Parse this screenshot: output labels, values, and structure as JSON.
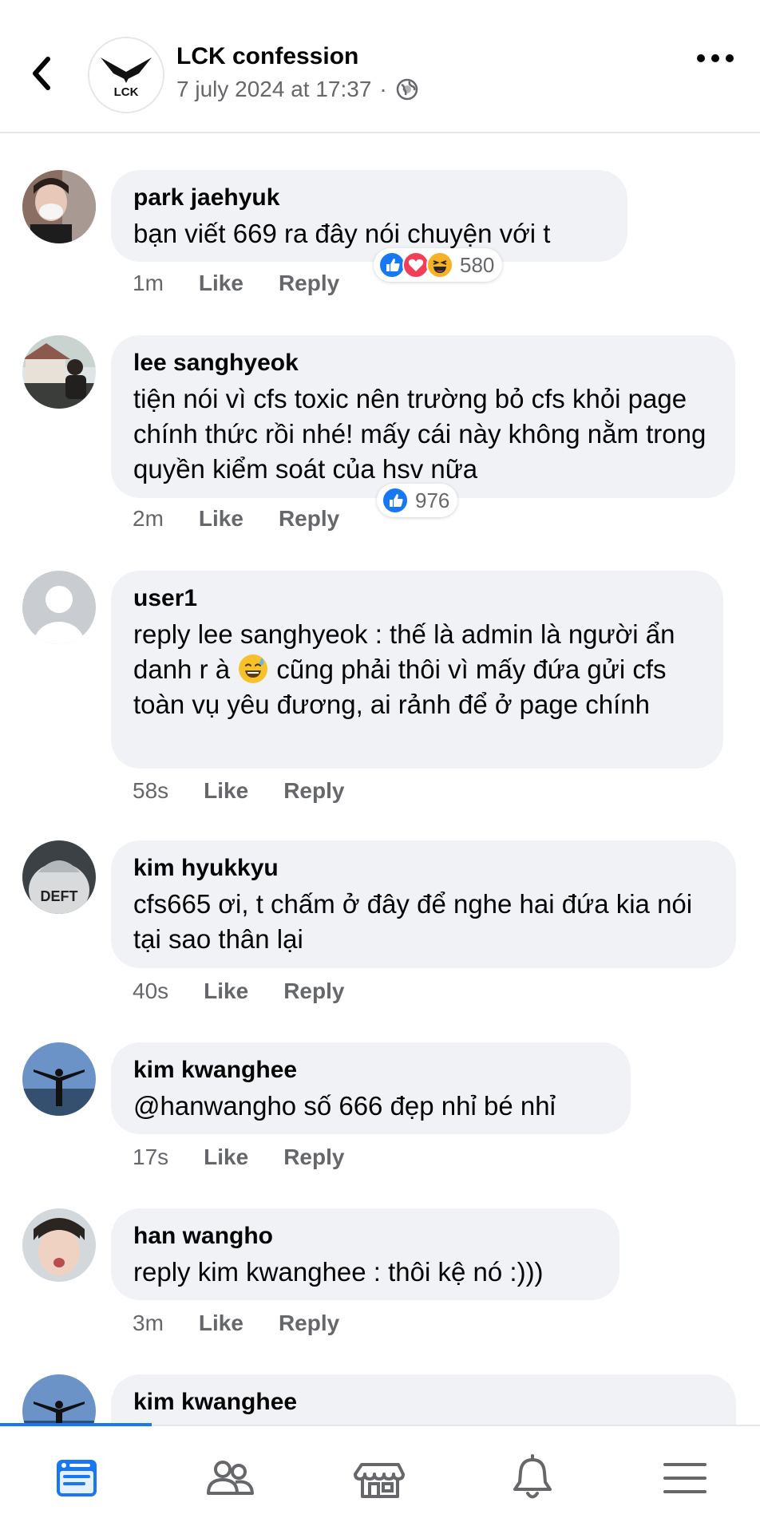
{
  "header": {
    "page_name": "LCK confession",
    "post_date": "7 july 2024 at 17:37",
    "separator": "·",
    "logo_text": "LCK"
  },
  "comments": [
    {
      "author": "park jaehyuk",
      "text": "bạn viết 669 ra đây nói chuyện với t",
      "time": "1m",
      "like_label": "Like",
      "reply_label": "Reply",
      "reactions": [
        "like-icon",
        "love-icon",
        "haha-icon"
      ],
      "reaction_count": "580"
    },
    {
      "author": "lee sanghyeok",
      "text": "tiện nói vì cfs toxic nên trường bỏ cfs khỏi page chính thức rồi nhé! mấy cái này không nằm trong quyền kiểm soát của hsv nữa",
      "time": "2m",
      "like_label": "Like",
      "reply_label": "Reply",
      "reactions": [
        "like-icon"
      ],
      "reaction_count": "976"
    },
    {
      "author": "user1",
      "text_before_emoji": "reply lee sanghyeok : thế là admin là người ẩn danh r à",
      "emoji": "sweat-smile-emoji",
      "text_after_emoji": " cũng phải thôi vì mấy đứa gửi cfs toàn vụ yêu đương, ai rảnh để ở page chính",
      "time": "58s",
      "like_label": "Like",
      "reply_label": "Reply"
    },
    {
      "author": "kim hyukkyu",
      "text": "cfs665 ơi, t chấm ở đây để nghe hai đứa kia nói tại sao thân lại",
      "time": "40s",
      "like_label": "Like",
      "reply_label": "Reply",
      "avatar_text": "DEFT"
    },
    {
      "author": "kim kwanghee",
      "text": "@hanwangho số 666 đẹp nhỉ bé nhỉ",
      "time": "17s",
      "like_label": "Like",
      "reply_label": "Reply"
    },
    {
      "author": "han wangho",
      "text": "reply kim kwanghee : thôi kệ nó :)))",
      "time": "3m",
      "like_label": "Like",
      "reply_label": "Reply"
    },
    {
      "author": "kim kwanghee"
    }
  ],
  "bottom_nav": {
    "items": [
      "feed-icon",
      "friends-icon",
      "marketplace-icon",
      "notifications-icon",
      "menu-icon"
    ],
    "active": "feed-icon"
  },
  "colors": {
    "accent": "#1877f2",
    "bubble": "#f0f2f5",
    "secondary_text": "#65676b"
  }
}
